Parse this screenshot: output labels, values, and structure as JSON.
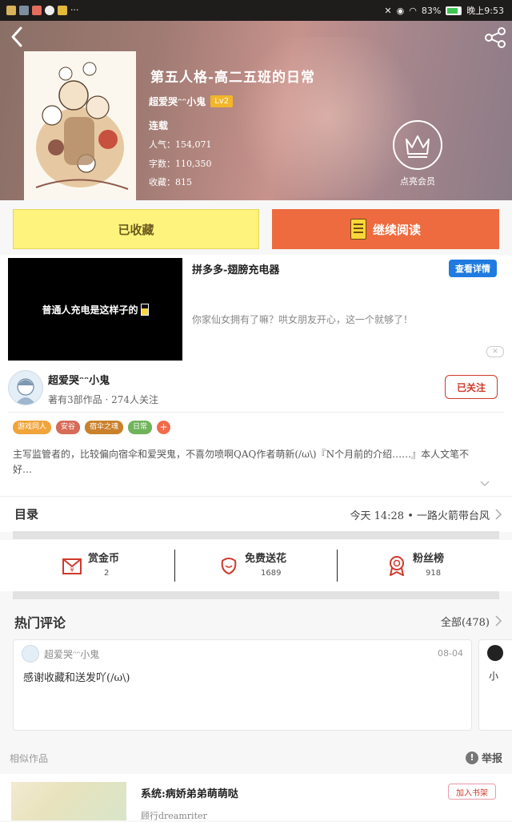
{
  "status_bar": {
    "battery": "83%",
    "time": "晚上9:53",
    "dots": "···"
  },
  "hero": {
    "title": "第五人格-高二五班的日常",
    "author": "超爱哭ᵔᵔ小鬼",
    "level": "Lv2",
    "status": "连载",
    "popularity": "人气：154,071",
    "word_count": "字数：110,350",
    "favorites": "收藏：815",
    "vip_label": "点亮会员"
  },
  "actions": {
    "collected_label": "已收藏",
    "read_label": "继续阅读"
  },
  "ad": {
    "video_text": "普通人充电是这样子的",
    "title": "拼多多-翅膀充电器",
    "button": "查看详情",
    "description": "你家仙女拥有了嘛？哄女朋友开心，这一个就够了！",
    "close": "✕"
  },
  "author_section": {
    "name": "超爱哭ᵔᵔ小鬼",
    "meta": "著有3部作品 · 274人关注",
    "follow_label": "已关注",
    "tags": [
      {
        "label": "游戏同人",
        "color": "#f0a43a"
      },
      {
        "label": "安谷",
        "color": "#d66b58"
      },
      {
        "label": "宿伞之魂",
        "color": "#c9812b"
      },
      {
        "label": "日常",
        "color": "#6fb35b"
      }
    ],
    "tag_more": "+",
    "intro": "主写监管者的，比较偏向宿伞和爱哭鬼，不喜勿喷啊QAQ作者萌新(/ω\\)『N个月前的介绍……』本人文笔不好…"
  },
  "catalog": {
    "label": "目录",
    "latest": "今天 14:28 • 一路火箭带台风"
  },
  "stats": [
    {
      "label": "赏金币",
      "value": "2",
      "icon": "coin-envelope-icon"
    },
    {
      "label": "免费送花",
      "value": "1689",
      "icon": "flower-icon"
    },
    {
      "label": "粉丝榜",
      "value": "918",
      "icon": "medal-icon"
    }
  ],
  "comments": {
    "heading": "热门评论",
    "all_label": "全部(478)",
    "items": [
      {
        "name": "超爱哭ᵔᵔ小鬼",
        "date": "08-04",
        "text": "感谢收藏和送发吖(/ω\\)"
      },
      {
        "name": "小"
      }
    ]
  },
  "similar": {
    "heading": "相似作品",
    "report": "举报",
    "report_icon": "!",
    "item": {
      "title": "系统:病娇弟弟萌萌哒",
      "author": "顾行dreamriter",
      "add_label": "加入书架"
    }
  },
  "colors": {
    "accent_orange": "#ed6b3f",
    "collected_yellow": "#fdf37d",
    "follow_red": "#d0392b",
    "link_blue": "#1f7be0"
  }
}
